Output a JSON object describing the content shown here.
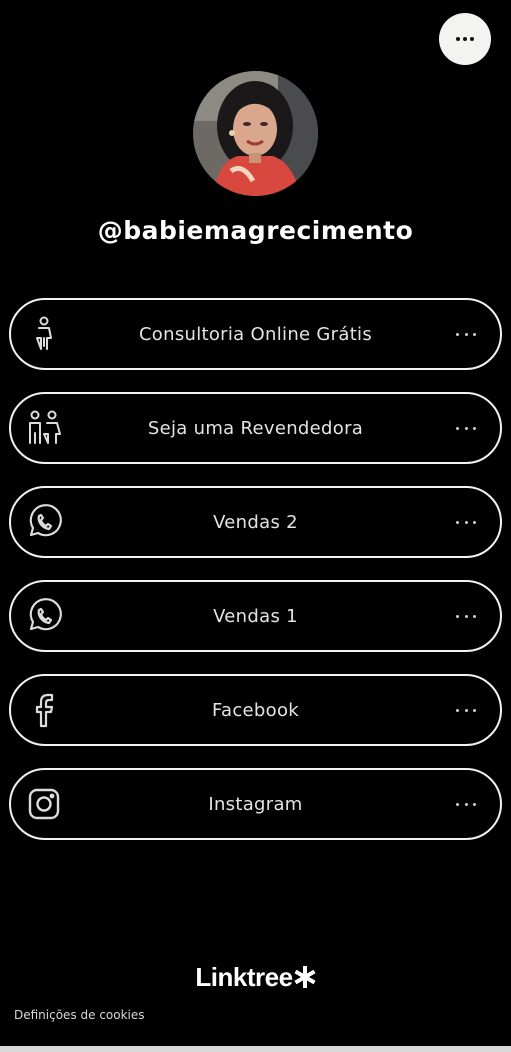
{
  "profile": {
    "username": "@babiemagrecimento",
    "avatar_icon": "profile-photo"
  },
  "menu": {
    "icon": "more-horizontal-icon"
  },
  "links": [
    {
      "label": "Consultoria Online Grátis",
      "icon": "person-icon"
    },
    {
      "label": "Seja uma Revendedora",
      "icon": "people-icon"
    },
    {
      "label": "Vendas 2",
      "icon": "whatsapp-icon"
    },
    {
      "label": "Vendas 1",
      "icon": "whatsapp-icon"
    },
    {
      "label": "Facebook",
      "icon": "facebook-icon"
    },
    {
      "label": "Instagram",
      "icon": "instagram-icon"
    }
  ],
  "footer": {
    "brand": "Linktree",
    "cookies_label": "Definições de cookies"
  },
  "colors": {
    "background": "#000000",
    "border": "#f2f2f2",
    "text": "#e3e3e3"
  }
}
